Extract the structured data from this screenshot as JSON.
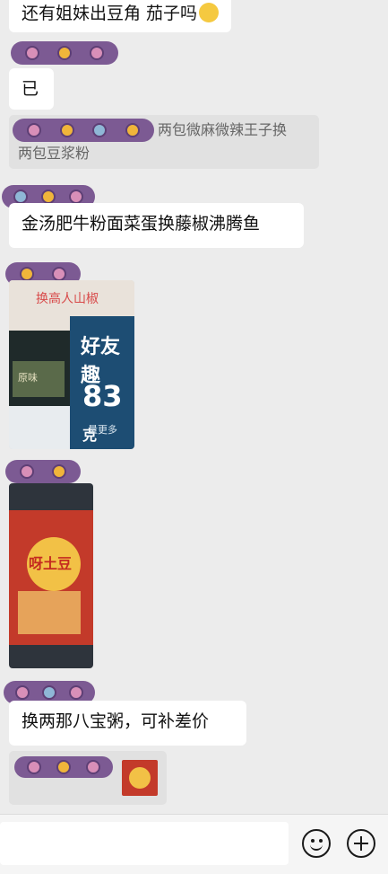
{
  "messages": {
    "m1_text": "还有姐妹出豆角 茄子吗",
    "m2_text": "已",
    "quote_line1": "两包微麻微辣王子换",
    "quote_line2": "两包豆浆粉",
    "m3_text": "金汤肥牛粉面菜蛋换藤椒沸腾鱼",
    "photo1_caption": "换高人山椒",
    "photo1_brand": "好友趣",
    "photo1_weight": "83",
    "photo1_unit": "克",
    "photo1_sub": "量更多",
    "photo1_left": "原味",
    "photo2_brand": "呀土豆",
    "m4_text": "换两那八宝粥，可补差价"
  },
  "icons": {
    "emoji": "smiley-icon",
    "more": "plus-circle-icon"
  },
  "colors": {
    "background": "#ececec",
    "bubble": "#ffffff",
    "quote": "#e1e1e1",
    "scribble": "#7c5a93"
  }
}
